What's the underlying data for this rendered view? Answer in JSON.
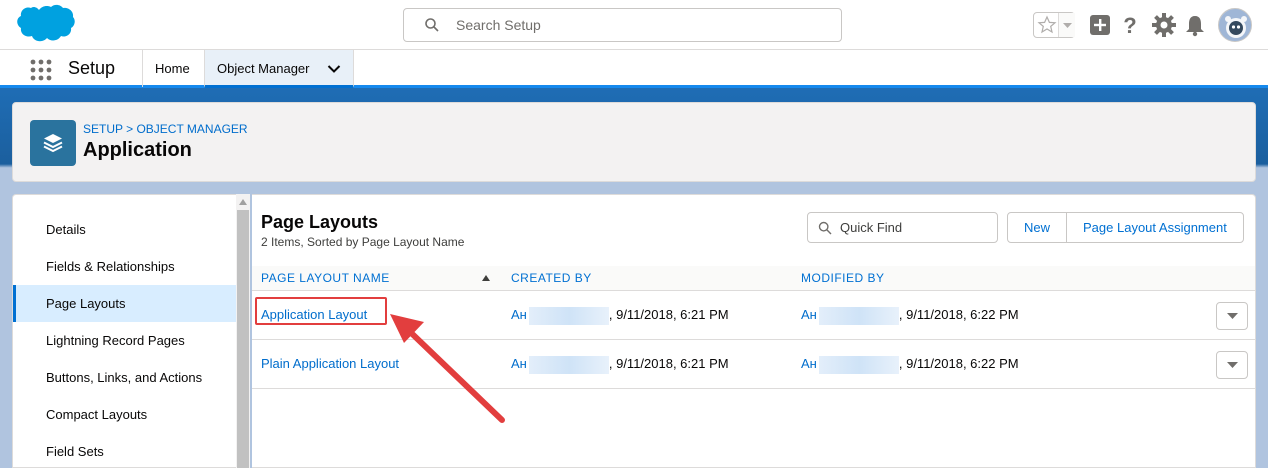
{
  "header": {
    "search_placeholder": "Search Setup"
  },
  "context_bar": {
    "app_name": "Setup",
    "tabs": [
      {
        "label": "Home"
      },
      {
        "label": "Object Manager"
      }
    ]
  },
  "object": {
    "breadcrumb": "SETUP > OBJECT MANAGER",
    "title": "Application"
  },
  "left_nav": {
    "items": [
      {
        "label": "Details"
      },
      {
        "label": "Fields & Relationships"
      },
      {
        "label": "Page Layouts",
        "active": true
      },
      {
        "label": "Lightning Record Pages"
      },
      {
        "label": "Buttons, Links, and Actions"
      },
      {
        "label": "Compact Layouts"
      },
      {
        "label": "Field Sets"
      }
    ]
  },
  "main": {
    "title": "Page Layouts",
    "subtitle": "2 Items, Sorted by Page Layout Name",
    "quick_find_placeholder": "Quick Find",
    "buttons": {
      "new": "New",
      "assignment": "Page Layout Assignment"
    },
    "columns": {
      "name": "PAGE LAYOUT NAME",
      "created": "CREATED BY",
      "modified": "MODIFIED BY"
    },
    "rows": [
      {
        "name": "Application Layout",
        "created_user": "Ан",
        "created_date": ", 9/11/2018, 6:21 PM",
        "modified_user": "Ан",
        "modified_date": ", 9/11/2018, 6:22 PM"
      },
      {
        "name": "Plain Application Layout",
        "created_user": "Ан",
        "created_date": ", 9/11/2018, 6:21 PM",
        "modified_user": "Ан",
        "modified_date": ", 9/11/2018, 6:22 PM"
      }
    ]
  },
  "colors": {
    "brand_blue": "#0070d2",
    "link_blue": "#006dcc",
    "object_icon": "#2a739e",
    "annotation_red": "#e23e3e"
  }
}
